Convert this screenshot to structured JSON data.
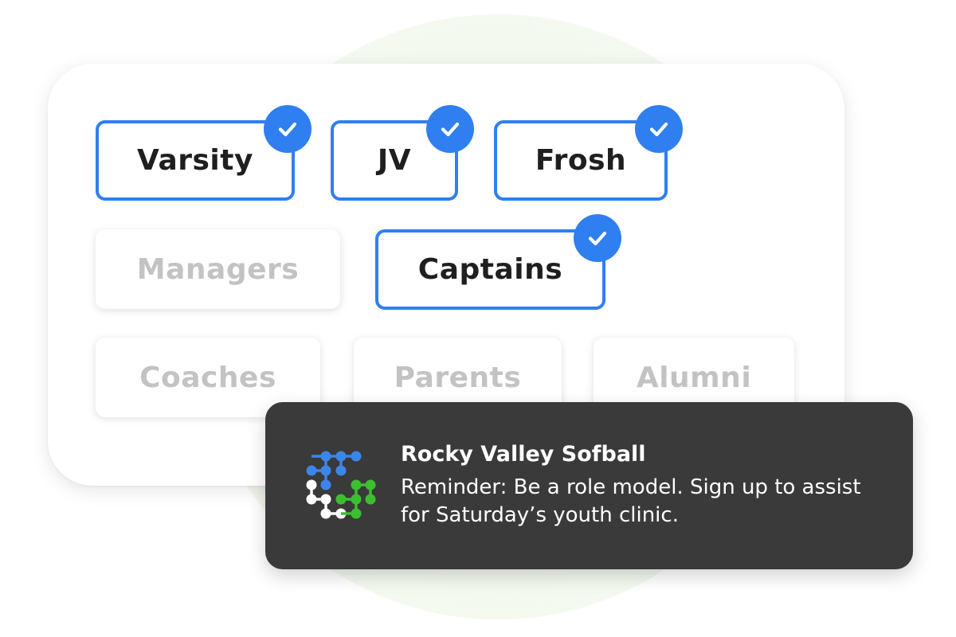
{
  "groups": {
    "varsity": {
      "label": "Varsity",
      "selected": true
    },
    "jv": {
      "label": "JV",
      "selected": true
    },
    "frosh": {
      "label": "Frosh",
      "selected": true
    },
    "managers": {
      "label": "Managers",
      "selected": false
    },
    "captains": {
      "label": "Captains",
      "selected": true
    },
    "coaches": {
      "label": "Coaches",
      "selected": false
    },
    "parents": {
      "label": "Parents",
      "selected": false
    },
    "alumni": {
      "label": "Alumni",
      "selected": false
    }
  },
  "notification": {
    "app_icon": "team-logo-icon",
    "title": "Rocky Valley Sofball",
    "message": "Reminder: Be a role model. Sign up to assist for Saturday’s youth clinic."
  },
  "colors": {
    "accent": "#2f7ff0",
    "selected_text": "#1f1f1f",
    "unselected_text": "#c3c3c3",
    "toast_background": "#3a3a3a",
    "logo_blue": "#3b86e8",
    "logo_green": "#3bbf2f",
    "background_tint": "#f1f8ea"
  }
}
